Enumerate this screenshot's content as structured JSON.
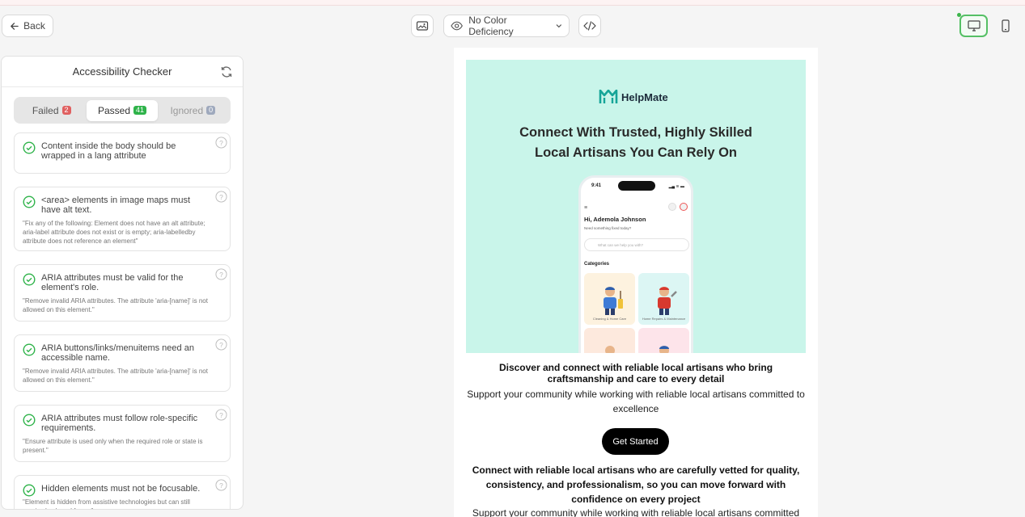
{
  "toolbar": {
    "back_label": "Back",
    "color_deficiency": "No Color Deficiency"
  },
  "panel": {
    "title": "Accessibility Checker",
    "tabs": [
      {
        "label": "Failed",
        "count": "2"
      },
      {
        "label": "Passed",
        "count": "41"
      },
      {
        "label": "Ignored",
        "count": "0"
      }
    ],
    "rules": [
      {
        "title": "Content inside the body should be wrapped in a lang attribute",
        "detail": ""
      },
      {
        "title": "<area> elements in image maps must have alt text.",
        "detail": "\"Fix any of the following: Element does not have an alt attribute; aria-label attribute does not exist or is empty; aria-labelledby attribute does not reference an element\""
      },
      {
        "title": "ARIA attributes must be valid for the element's role.",
        "detail": "\"Remove invalid ARIA attributes. The attribute 'aria-[name]' is not allowed on this element.\""
      },
      {
        "title": "ARIA buttons/links/menuitems need an accessible name.",
        "detail": "\"Remove invalid ARIA attributes. The attribute 'aria-[name]' is not allowed on this element.\""
      },
      {
        "title": "ARIA attributes must follow role-specific requirements.",
        "detail": "\"Ensure attribute is used only when the required role or state is present.\""
      },
      {
        "title": "Hidden elements must not be focusable.",
        "detail": "\"Element is hidden from assistive technologies but can still receive keyboard focus.\""
      }
    ]
  },
  "preview": {
    "logo_text": "HelpMate",
    "hero_heading_line1": "Connect With Trusted, Highly Skilled",
    "hero_heading_line2": "Local Artisans You Can Rely On",
    "phone": {
      "time": "9:41",
      "greeting": "Hi, Ademola Johnson",
      "subtitle": "Need something fixed today?",
      "search_placeholder": "What can we help you with?",
      "categories_label": "Categories",
      "tile1": "Cleaning & Home Care",
      "tile2": "Home Repairs & Maintenance"
    },
    "discover": "Discover and connect with reliable local artisans who bring craftsmanship and care to every detail",
    "support": "Support your community while working with reliable local artisans committed to excellence",
    "cta": "Get Started",
    "connect": "Connect with reliable local artisans who are carefully vetted for quality, consistency, and professionalism, so you can move forward with confidence on every project",
    "support2": "Support your community while working with reliable local artisans committed"
  },
  "colors": {
    "hero_bg": "#c9f5ea",
    "pass_green": "#2fb34a",
    "fail_red": "#e06060",
    "cta_bg": "#000000"
  }
}
